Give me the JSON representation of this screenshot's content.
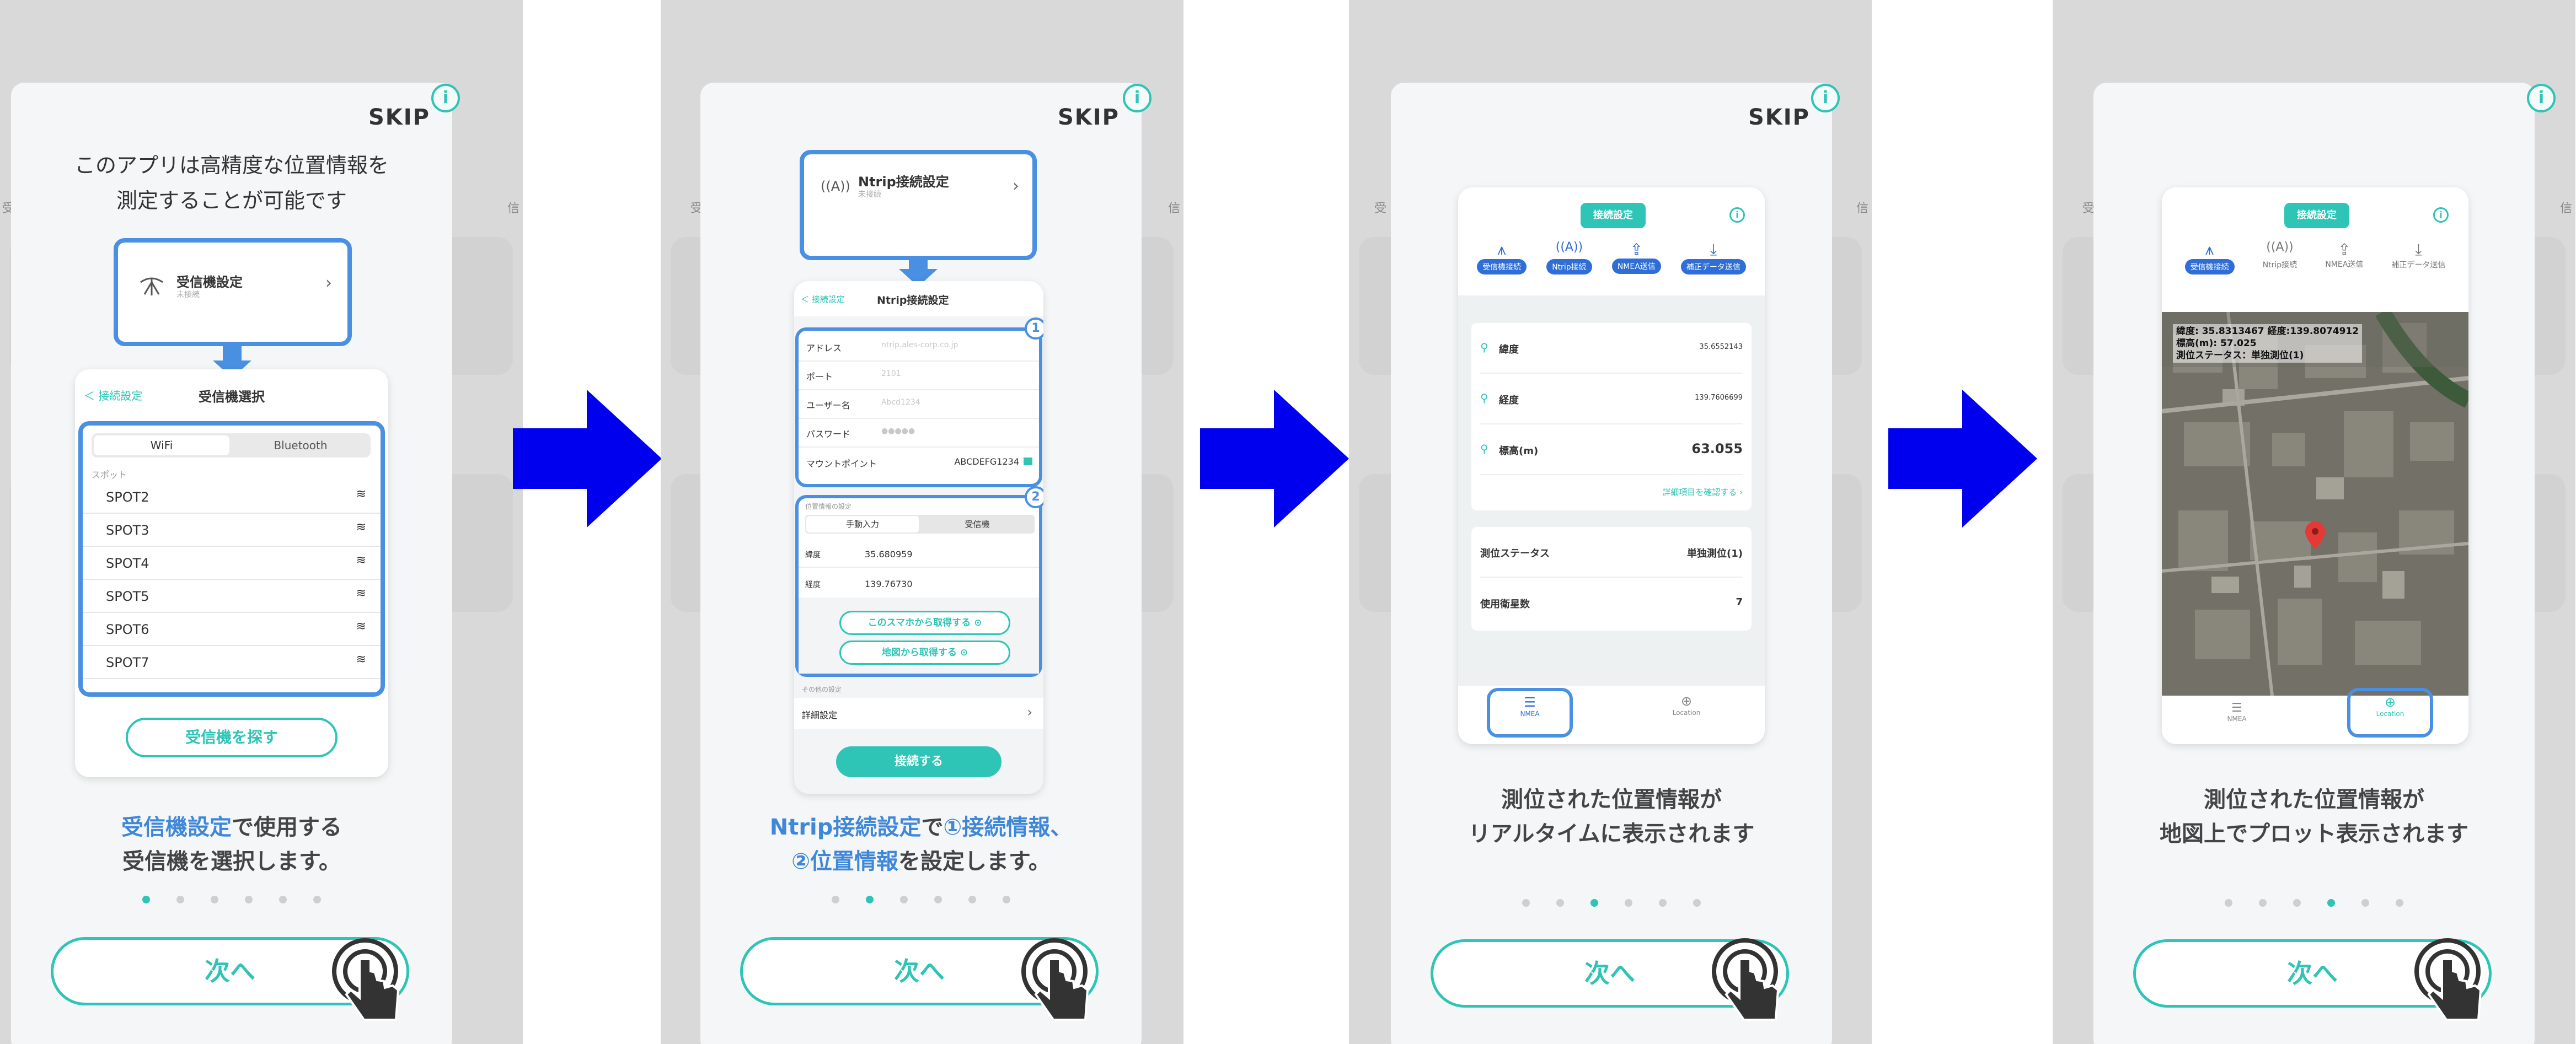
{
  "skip_label": "SKIP",
  "next_label": "次へ",
  "info_glyph": "i",
  "screens": [
    {
      "lead": [
        "このアプリは高精度な位置情報を",
        "測定することが可能です"
      ],
      "receiver_card": {
        "title": "受信機設定",
        "sub": "未接続"
      },
      "select_screen": {
        "back": "＜ 接続設定",
        "title": "受信機選択",
        "tabs": [
          "WiFi",
          "Bluetooth"
        ],
        "section": "スポット",
        "spots": [
          "SPOT2",
          "SPOT3",
          "SPOT4",
          "SPOT5",
          "SPOT6",
          "SPOT7"
        ],
        "search_button": "受信機を探す"
      },
      "caption_hl": "受信機設定",
      "caption_rest": "で使用する",
      "caption_line2": "受信機を選択します。",
      "dots_active": 0
    },
    {
      "ntrip_card": {
        "title": "Ntrip接続設定",
        "sub": "未接続"
      },
      "form": {
        "back": "＜ 接続設定",
        "title": "Ntrip接続設定",
        "fields": [
          {
            "label": "アドレス",
            "value": "ntrip.ales-corp.co.jp"
          },
          {
            "label": "ポート",
            "value": "2101"
          },
          {
            "label": "ユーザー名",
            "value": "Abcd1234"
          },
          {
            "label": "パスワード",
            "value": "●●●●●"
          }
        ],
        "mount_label": "マウントポイント",
        "mount_value": "ABCDEFG1234",
        "pos_section": "位置情報の設定",
        "pos_tabs": [
          "手動入力",
          "受信機"
        ],
        "lat_label": "緯度",
        "lat_value": "35.680959",
        "lng_label": "経度",
        "lng_value": "139.76730",
        "btn_phone": "このスマホから取得する",
        "btn_map": "地図から取得する",
        "other_section": "その他の設定",
        "detail": "詳細設定",
        "connect": "接続する",
        "badge1": "1",
        "badge2": "2"
      },
      "caption_line1_a": "Ntrip接続設定",
      "caption_line1_b": "で",
      "caption_line1_c": "①接続情報",
      "caption_line1_d": "、",
      "caption_line2_a": "②位置情報",
      "caption_line2_b": "を設定します。",
      "dots_active": 1
    },
    {
      "header_btn": "接続設定",
      "tabs": [
        "受信機接続",
        "Ntrip接続",
        "NMEA送信",
        "補正データ送信"
      ],
      "rows": [
        {
          "label": "緯度",
          "value": "35.6552143"
        },
        {
          "label": "経度",
          "value": "139.7606699"
        },
        {
          "label": "標高(m)",
          "value": "63.055"
        }
      ],
      "detail_link": "詳細項目を確認する ›",
      "status_rows": [
        {
          "label": "測位ステータス",
          "value": "単独測位(1)"
        },
        {
          "label": "使用衛星数",
          "value": "7"
        }
      ],
      "bottom_tabs": [
        "NMEA",
        "Location"
      ],
      "caption": [
        "測位された位置情報が",
        "リアルタイムに表示されます"
      ],
      "dots_active": 2
    },
    {
      "header_btn": "接続設定",
      "tabs": [
        "受信機接続",
        "Ntrip接続",
        "NMEA送信",
        "補正データ送信"
      ],
      "map_overlay": [
        "緯度: 35.8313467  経度:139.8074912",
        "標高(m): 57.025",
        "測位ステータス：単独測位(1)"
      ],
      "bottom_tabs": [
        "NMEA",
        "Location"
      ],
      "caption": [
        "測位された位置情報が",
        "地図上でプロット表示されます"
      ],
      "dots_active": 3
    }
  ],
  "colors": {
    "teal": "#2ec4b6",
    "blue": "#4a90e2",
    "arrow": "#0000ee",
    "highlight": "#3f87d8"
  },
  "icons": [
    "antenna-icon",
    "chevron-right-icon",
    "wifi-icon",
    "info-icon",
    "tap-hand-icon",
    "arrow-right-icon",
    "location-pin-icon",
    "list-icon",
    "target-icon",
    "upload-icon",
    "download-icon"
  ]
}
